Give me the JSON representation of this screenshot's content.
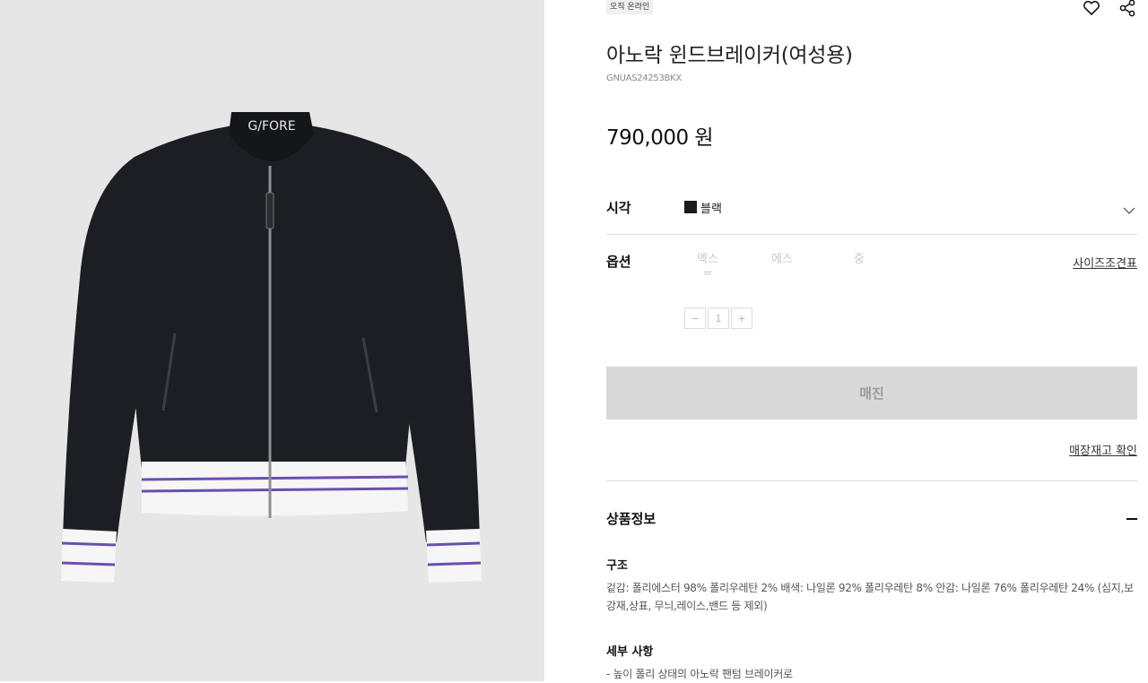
{
  "product": {
    "badge": "오직 온라인",
    "name": "아노락 윈드브레이커(여성용)",
    "code": "GNUAS24253BKX",
    "price": "790,000 원",
    "image_logo_text": "G/FORE"
  },
  "icons": {
    "wishlist": "heart-icon",
    "share": "share-icon",
    "dropdown": "chevron-down-icon"
  },
  "color_option": {
    "label": "시각",
    "value": "블랙",
    "swatch": "#1a1a1a"
  },
  "size_option": {
    "label": "옵션",
    "sizes": [
      "엑스\n=",
      "에스",
      "중"
    ],
    "size_chart_link": "사이즈조견표"
  },
  "quantity": {
    "minus": "−",
    "value": "1",
    "plus": "+"
  },
  "buttons": {
    "sold_out": "매진",
    "store_stock": "매장재고 확인"
  },
  "product_info": {
    "title": "상품정보",
    "composition_title": "구조",
    "composition_text": "겉감: 폴리에스터 98% 폴리우레탄 2% 배색: 나일론 92% 폴리우레탄 8% 안감: 나일론 76% 폴리우레탄 24% (심지,보강재,상표, 무늬,레이스,밴드 등 제외)",
    "details_title": "세부 사항",
    "details_text": "- 높이 폴리 상태의 아노락 팬텀 브레이커로"
  },
  "colors": {
    "jacket": "#1c1e24",
    "stripe": "#6a4fb0",
    "button_bg": "#d9d9d9",
    "image_bg": "#e6e6e6"
  }
}
